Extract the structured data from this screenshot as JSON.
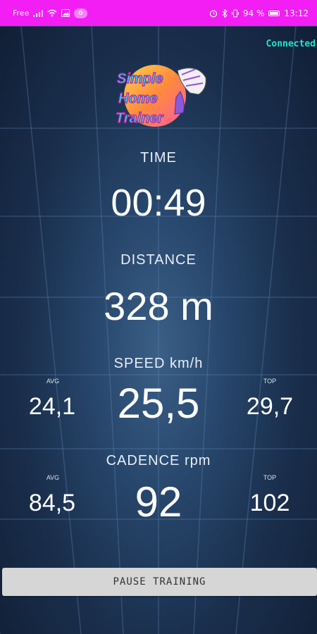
{
  "status_bar": {
    "carrier": "Free",
    "notification_count": "6",
    "battery": "94 %",
    "time": "13:12"
  },
  "connection_status": "Connected",
  "logo": {
    "line1": "Simple",
    "line2": "Home",
    "line3": "Trainer"
  },
  "time": {
    "label": "TIME",
    "value": "00:49"
  },
  "distance": {
    "label": "DISTANCE",
    "value": "328 m"
  },
  "speed": {
    "label": "SPEED km/h",
    "value": "25,5",
    "avg_label": "AVG",
    "avg_value": "24,1",
    "top_label": "TOP",
    "top_value": "29,7"
  },
  "cadence": {
    "label": "CADENCE rpm",
    "value": "92",
    "avg_label": "AVG",
    "avg_value": "84,5",
    "top_label": "TOP",
    "top_value": "102"
  },
  "pause_button": "PAUSE TRAINING"
}
